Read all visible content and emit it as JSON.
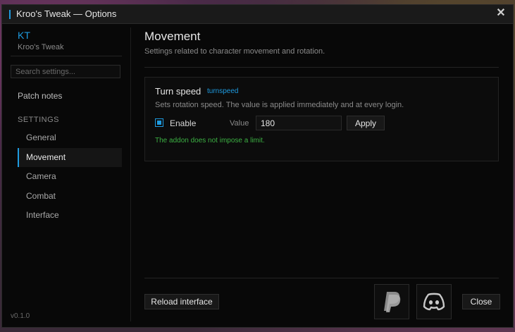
{
  "window": {
    "title": "Kroo's Tweak — Options",
    "close_icon": "close-icon"
  },
  "sidebar": {
    "brand_abbr": "KT",
    "brand_name": "Kroo's Tweak",
    "search_placeholder": "Search settings...",
    "patch_notes": "Patch notes",
    "section_label": "SETTINGS",
    "items": [
      {
        "label": "General",
        "active": false
      },
      {
        "label": "Movement",
        "active": true
      },
      {
        "label": "Camera",
        "active": false
      },
      {
        "label": "Combat",
        "active": false
      },
      {
        "label": "Interface",
        "active": false
      }
    ],
    "version": "v0.1.0"
  },
  "main": {
    "title": "Movement",
    "subtitle": "Settings related to character movement and rotation.",
    "setting": {
      "title": "Turn speed",
      "tag": "turnspeed",
      "description": "Sets rotation speed. The value is applied immediately and at every login.",
      "enable_label": "Enable",
      "enabled": true,
      "value_label": "Value",
      "value": "180",
      "apply_label": "Apply",
      "note": "The addon does not impose a limit."
    }
  },
  "footer": {
    "reload_label": "Reload interface",
    "paypal_icon": "paypal-icon",
    "discord_icon": "discord-icon",
    "close_label": "Close"
  },
  "colors": {
    "accent": "#1e9be0",
    "note_green": "#3cb043",
    "background": "#080808"
  }
}
